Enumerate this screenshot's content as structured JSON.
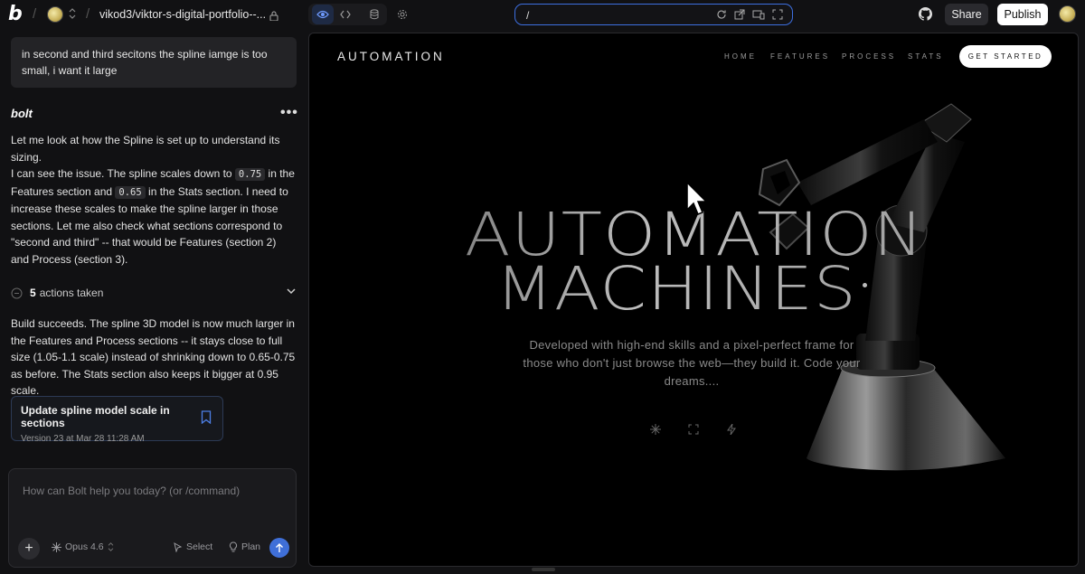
{
  "topbar": {
    "logo": "b",
    "project_name": "vikod3/viktor-s-digital-portfolio--...",
    "url_value": "/",
    "share_label": "Share",
    "publish_label": "Publish"
  },
  "chat": {
    "user_message": "in second and third secitons the spline iamge is too small, i want it large",
    "assistant_name": "bolt",
    "para1": "Let me look at how the Spline is set up to understand its sizing.",
    "para2_a": "I can see the issue. The spline scales down to ",
    "para2_code1": "0.75",
    "para2_b": " in the Features section and ",
    "para2_code2": "0.65",
    "para2_c": " in the Stats section. I need to increase these scales to make the spline larger in those sections. Let me also check what sections correspond to \"second and third\" -- that would be Features (section 2) and Process (section 3).",
    "actions_count": "5",
    "actions_label": "actions taken",
    "para3": "Build succeeds. The spline 3D model is now much larger in the Features and Process sections -- it stays close to full size (1.05-1.1 scale) instead of shrinking down to 0.65-0.75 as before. The Stats section also keeps it bigger at 0.95 scale.",
    "version_title": "Update spline model scale in sections",
    "version_sub": "Version 23 at Mar 28 11:28 AM",
    "input_placeholder": "How can Bolt help you today? (or /command)",
    "model_label": "Opus 4.6",
    "select_label": "Select",
    "plan_label": "Plan"
  },
  "preview": {
    "brand": "AUTOMATION",
    "nav": [
      "HOME",
      "FEATURES",
      "PROCESS",
      "STATS"
    ],
    "cta": "GET STARTED",
    "hero_line1": "AUTOMATION",
    "hero_line2": "MACHINES",
    "description": "Developed with high-end skills and a pixel-perfect frame for those who don't just browse the web—they build it. Code your dreams...."
  }
}
